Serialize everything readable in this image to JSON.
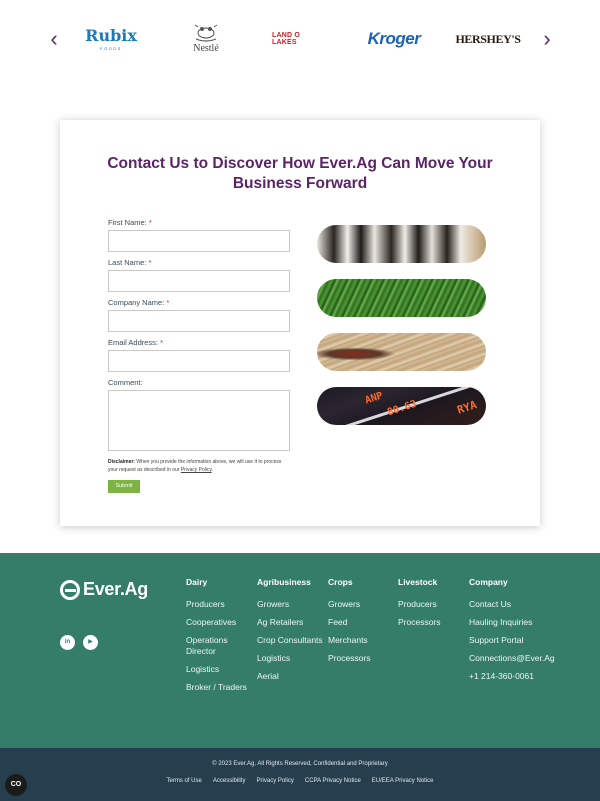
{
  "carousel": {
    "prev_icon": "chevron-left-icon",
    "next_icon": "chevron-right-icon",
    "brands": [
      {
        "name": "Rubix",
        "sub": "FOODS"
      },
      {
        "name": "Nestlé"
      },
      {
        "name": "LAND O LAKES"
      },
      {
        "name": "Kroger"
      },
      {
        "name": "HERSHEY'S"
      }
    ]
  },
  "contact": {
    "title": "Contact Us to Discover How Ever.Ag Can Move Your Business Forward",
    "fields": [
      {
        "label": "First Name:",
        "required": "*",
        "value": ""
      },
      {
        "label": "Last Name:",
        "required": "*",
        "value": ""
      },
      {
        "label": "Company Name:",
        "required": "*",
        "value": ""
      },
      {
        "label": "Email Address:",
        "required": "*",
        "value": ""
      },
      {
        "label": "Comment:",
        "value": ""
      }
    ],
    "disclaimer_label": "Disclaimer:",
    "disclaimer_text": "When you provide the information above, we will use it to process your request as described in our",
    "privacy_link": "Privacy Policy",
    "submit_label": "Submit",
    "images": [
      "cows",
      "grass",
      "harvest",
      "market"
    ],
    "tickers": [
      "ANP",
      "80.63",
      "RYA"
    ]
  },
  "footer": {
    "brand": "Ever.Ag",
    "social": [
      {
        "name": "linkedin-icon",
        "glyph": "in"
      },
      {
        "name": "youtube-icon",
        "glyph": "▶"
      }
    ],
    "columns": [
      {
        "heading": "Dairy",
        "links": [
          "Producers",
          "Cooperatives",
          "Operations Director",
          "Logistics",
          "Broker / Traders"
        ]
      },
      {
        "heading": "Agribusiness",
        "links": [
          "Growers",
          "Ag Retailers",
          "Crop Consultants",
          "Logistics",
          "Aerial"
        ]
      },
      {
        "heading": "Crops",
        "links": [
          "Growers",
          "Feed",
          "Merchants",
          "Processors"
        ]
      },
      {
        "heading": "Livestock",
        "links": [
          "Producers",
          "Processors"
        ]
      },
      {
        "heading": "Company",
        "links": [
          "Contact Us",
          "Hauling Inquiries",
          "Support Portal",
          "Connections@Ever.Ag",
          "+1 214-360-0061"
        ]
      }
    ],
    "copyright": "© 2023 Ever.Ag, All Rights Reserved, Confidential and Proprietary",
    "legal_links": [
      "Terms of Use",
      "Accessibility",
      "Privacy Policy",
      "CCPA Privacy Notice",
      "EU/EEA Privacy Notice"
    ]
  },
  "cookie_button": "CO",
  "colors": {
    "title_purple": "#5b2468",
    "footer_green": "#347d69",
    "legal_navy": "#253f4f",
    "submit_green": "#7cb342",
    "required_red": "#c62828"
  }
}
